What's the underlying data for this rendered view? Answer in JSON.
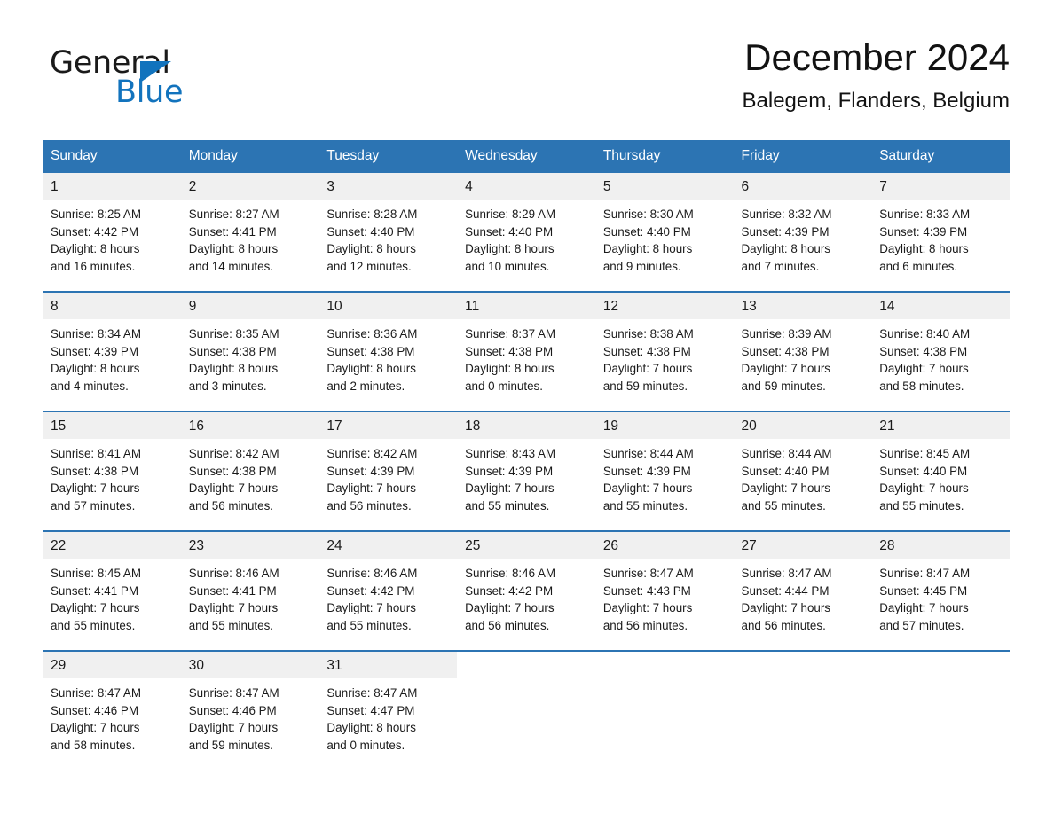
{
  "brand": {
    "name_part1": "General",
    "name_part2": "Blue",
    "triangle_color": "#1273bd",
    "text_color": "#1a1a1a"
  },
  "header": {
    "title": "December 2024",
    "subtitle": "Balegem, Flanders, Belgium"
  },
  "theme": {
    "header_bg": "#2c74b3",
    "header_text": "#ffffff",
    "daynum_bg": "#f0f0f0",
    "row_border": "#2c74b3",
    "page_bg": "#ffffff"
  },
  "weekday_headers": [
    "Sunday",
    "Monday",
    "Tuesday",
    "Wednesday",
    "Thursday",
    "Friday",
    "Saturday"
  ],
  "weeks": [
    [
      {
        "day": "1",
        "sunrise": "Sunrise: 8:25 AM",
        "sunset": "Sunset: 4:42 PM",
        "daylight1": "Daylight: 8 hours",
        "daylight2": "and 16 minutes."
      },
      {
        "day": "2",
        "sunrise": "Sunrise: 8:27 AM",
        "sunset": "Sunset: 4:41 PM",
        "daylight1": "Daylight: 8 hours",
        "daylight2": "and 14 minutes."
      },
      {
        "day": "3",
        "sunrise": "Sunrise: 8:28 AM",
        "sunset": "Sunset: 4:40 PM",
        "daylight1": "Daylight: 8 hours",
        "daylight2": "and 12 minutes."
      },
      {
        "day": "4",
        "sunrise": "Sunrise: 8:29 AM",
        "sunset": "Sunset: 4:40 PM",
        "daylight1": "Daylight: 8 hours",
        "daylight2": "and 10 minutes."
      },
      {
        "day": "5",
        "sunrise": "Sunrise: 8:30 AM",
        "sunset": "Sunset: 4:40 PM",
        "daylight1": "Daylight: 8 hours",
        "daylight2": "and 9 minutes."
      },
      {
        "day": "6",
        "sunrise": "Sunrise: 8:32 AM",
        "sunset": "Sunset: 4:39 PM",
        "daylight1": "Daylight: 8 hours",
        "daylight2": "and 7 minutes."
      },
      {
        "day": "7",
        "sunrise": "Sunrise: 8:33 AM",
        "sunset": "Sunset: 4:39 PM",
        "daylight1": "Daylight: 8 hours",
        "daylight2": "and 6 minutes."
      }
    ],
    [
      {
        "day": "8",
        "sunrise": "Sunrise: 8:34 AM",
        "sunset": "Sunset: 4:39 PM",
        "daylight1": "Daylight: 8 hours",
        "daylight2": "and 4 minutes."
      },
      {
        "day": "9",
        "sunrise": "Sunrise: 8:35 AM",
        "sunset": "Sunset: 4:38 PM",
        "daylight1": "Daylight: 8 hours",
        "daylight2": "and 3 minutes."
      },
      {
        "day": "10",
        "sunrise": "Sunrise: 8:36 AM",
        "sunset": "Sunset: 4:38 PM",
        "daylight1": "Daylight: 8 hours",
        "daylight2": "and 2 minutes."
      },
      {
        "day": "11",
        "sunrise": "Sunrise: 8:37 AM",
        "sunset": "Sunset: 4:38 PM",
        "daylight1": "Daylight: 8 hours",
        "daylight2": "and 0 minutes."
      },
      {
        "day": "12",
        "sunrise": "Sunrise: 8:38 AM",
        "sunset": "Sunset: 4:38 PM",
        "daylight1": "Daylight: 7 hours",
        "daylight2": "and 59 minutes."
      },
      {
        "day": "13",
        "sunrise": "Sunrise: 8:39 AM",
        "sunset": "Sunset: 4:38 PM",
        "daylight1": "Daylight: 7 hours",
        "daylight2": "and 59 minutes."
      },
      {
        "day": "14",
        "sunrise": "Sunrise: 8:40 AM",
        "sunset": "Sunset: 4:38 PM",
        "daylight1": "Daylight: 7 hours",
        "daylight2": "and 58 minutes."
      }
    ],
    [
      {
        "day": "15",
        "sunrise": "Sunrise: 8:41 AM",
        "sunset": "Sunset: 4:38 PM",
        "daylight1": "Daylight: 7 hours",
        "daylight2": "and 57 minutes."
      },
      {
        "day": "16",
        "sunrise": "Sunrise: 8:42 AM",
        "sunset": "Sunset: 4:38 PM",
        "daylight1": "Daylight: 7 hours",
        "daylight2": "and 56 minutes."
      },
      {
        "day": "17",
        "sunrise": "Sunrise: 8:42 AM",
        "sunset": "Sunset: 4:39 PM",
        "daylight1": "Daylight: 7 hours",
        "daylight2": "and 56 minutes."
      },
      {
        "day": "18",
        "sunrise": "Sunrise: 8:43 AM",
        "sunset": "Sunset: 4:39 PM",
        "daylight1": "Daylight: 7 hours",
        "daylight2": "and 55 minutes."
      },
      {
        "day": "19",
        "sunrise": "Sunrise: 8:44 AM",
        "sunset": "Sunset: 4:39 PM",
        "daylight1": "Daylight: 7 hours",
        "daylight2": "and 55 minutes."
      },
      {
        "day": "20",
        "sunrise": "Sunrise: 8:44 AM",
        "sunset": "Sunset: 4:40 PM",
        "daylight1": "Daylight: 7 hours",
        "daylight2": "and 55 minutes."
      },
      {
        "day": "21",
        "sunrise": "Sunrise: 8:45 AM",
        "sunset": "Sunset: 4:40 PM",
        "daylight1": "Daylight: 7 hours",
        "daylight2": "and 55 minutes."
      }
    ],
    [
      {
        "day": "22",
        "sunrise": "Sunrise: 8:45 AM",
        "sunset": "Sunset: 4:41 PM",
        "daylight1": "Daylight: 7 hours",
        "daylight2": "and 55 minutes."
      },
      {
        "day": "23",
        "sunrise": "Sunrise: 8:46 AM",
        "sunset": "Sunset: 4:41 PM",
        "daylight1": "Daylight: 7 hours",
        "daylight2": "and 55 minutes."
      },
      {
        "day": "24",
        "sunrise": "Sunrise: 8:46 AM",
        "sunset": "Sunset: 4:42 PM",
        "daylight1": "Daylight: 7 hours",
        "daylight2": "and 55 minutes."
      },
      {
        "day": "25",
        "sunrise": "Sunrise: 8:46 AM",
        "sunset": "Sunset: 4:42 PM",
        "daylight1": "Daylight: 7 hours",
        "daylight2": "and 56 minutes."
      },
      {
        "day": "26",
        "sunrise": "Sunrise: 8:47 AM",
        "sunset": "Sunset: 4:43 PM",
        "daylight1": "Daylight: 7 hours",
        "daylight2": "and 56 minutes."
      },
      {
        "day": "27",
        "sunrise": "Sunrise: 8:47 AM",
        "sunset": "Sunset: 4:44 PM",
        "daylight1": "Daylight: 7 hours",
        "daylight2": "and 56 minutes."
      },
      {
        "day": "28",
        "sunrise": "Sunrise: 8:47 AM",
        "sunset": "Sunset: 4:45 PM",
        "daylight1": "Daylight: 7 hours",
        "daylight2": "and 57 minutes."
      }
    ],
    [
      {
        "day": "29",
        "sunrise": "Sunrise: 8:47 AM",
        "sunset": "Sunset: 4:46 PM",
        "daylight1": "Daylight: 7 hours",
        "daylight2": "and 58 minutes."
      },
      {
        "day": "30",
        "sunrise": "Sunrise: 8:47 AM",
        "sunset": "Sunset: 4:46 PM",
        "daylight1": "Daylight: 7 hours",
        "daylight2": "and 59 minutes."
      },
      {
        "day": "31",
        "sunrise": "Sunrise: 8:47 AM",
        "sunset": "Sunset: 4:47 PM",
        "daylight1": "Daylight: 8 hours",
        "daylight2": "and 0 minutes."
      },
      {
        "day": "",
        "sunrise": "",
        "sunset": "",
        "daylight1": "",
        "daylight2": ""
      },
      {
        "day": "",
        "sunrise": "",
        "sunset": "",
        "daylight1": "",
        "daylight2": ""
      },
      {
        "day": "",
        "sunrise": "",
        "sunset": "",
        "daylight1": "",
        "daylight2": ""
      },
      {
        "day": "",
        "sunrise": "",
        "sunset": "",
        "daylight1": "",
        "daylight2": ""
      }
    ]
  ]
}
